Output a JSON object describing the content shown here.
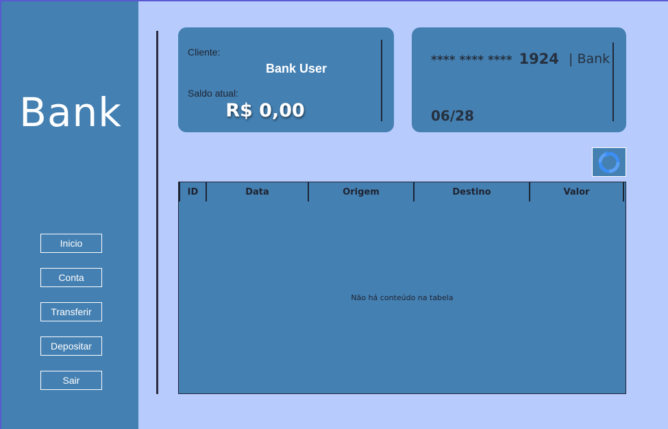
{
  "sidebar": {
    "brand": "Bank",
    "nav": [
      {
        "label": "Inicio"
      },
      {
        "label": "Conta"
      },
      {
        "label": "Transferir"
      },
      {
        "label": "Depositar"
      },
      {
        "label": "Sair"
      }
    ]
  },
  "client_card": {
    "client_label": "Cliente:",
    "client_name": "Bank User",
    "balance_label": "Saldo atual:",
    "balance": "R$ 0,00"
  },
  "bank_card": {
    "masked": "**** **** ****",
    "last4": "1924",
    "bank_name": "| Bank",
    "expiry": "06/28"
  },
  "refresh": {
    "icon": "refresh-icon",
    "color": "#3d8ef5"
  },
  "table": {
    "columns": [
      "ID",
      "Data",
      "Origem",
      "Destino",
      "Valor"
    ],
    "rows": [],
    "empty_message": "Não há conteúdo na tabela"
  },
  "colors": {
    "background": "#b8cbfd",
    "panel": "#4480b2",
    "accent": "#5a5ad0"
  }
}
